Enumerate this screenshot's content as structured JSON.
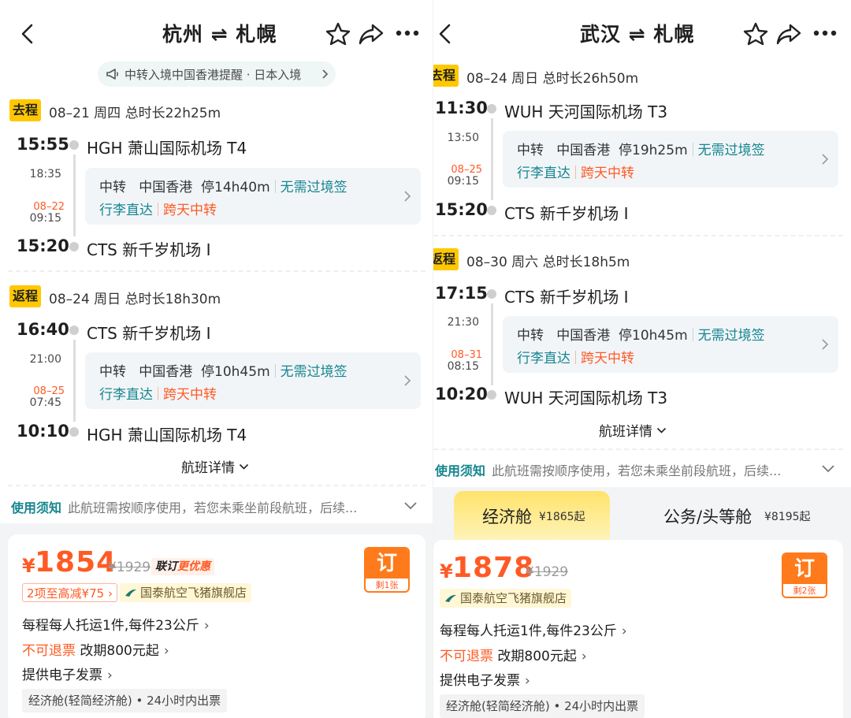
{
  "left": {
    "header": {
      "title": "杭州 ⇌ 札幌"
    },
    "notice": {
      "text": "中转入境中国香港提醒 · 日本入境"
    },
    "legs": [
      {
        "tag": "去程",
        "info": "08–21  周四  总时长22h25m",
        "dep_time": "15:55",
        "dep_airport": "HGH 萧山国际机场 T4",
        "mid_time1": "18:35",
        "mid_date2": "08–22",
        "mid_time2": "09:15",
        "transfer": {
          "label": "中转",
          "city": "中国香港",
          "stay": "停14h40m",
          "visa": "无需过境签",
          "baggage": "行李直达",
          "cross_day": "跨天中转"
        },
        "arr_time": "15:20",
        "arr_airport": "CTS 新千岁机场 I"
      },
      {
        "tag": "返程",
        "info": "08–24  周日  总时长18h30m",
        "dep_time": "16:40",
        "dep_airport": "CTS 新千岁机场 I",
        "mid_time1": "21:00",
        "mid_date2": "08–25",
        "mid_time2": "07:45",
        "transfer": {
          "label": "中转",
          "city": "中国香港",
          "stay": "停10h45m",
          "visa": "无需过境签",
          "baggage": "行李直达",
          "cross_day": "跨天中转"
        },
        "arr_time": "10:10",
        "arr_airport": "HGH 萧山国际机场 T4"
      }
    ],
    "flight_detail": "航班详情",
    "usage": {
      "label": "使用须知",
      "text": "此航班需按顺序使用，若您未乘坐前段航班，后续..."
    },
    "offer": {
      "currency": "¥",
      "price": "1854",
      "original": "¥1929",
      "combo_a": "联订",
      "combo_b": "更优惠",
      "promo": "2项至高减¥75",
      "store": "国泰航空飞猪旗舰店",
      "book_label": "订",
      "remaining": "剩1张",
      "baggage_rule": "每程每人托运1件,每件23公斤",
      "refund": "不可退票",
      "change": "改期800元起",
      "invoice": "提供电子发票",
      "cabin": "经济舱(轻简经济舱) • 24小时内出票"
    }
  },
  "right": {
    "header": {
      "title": "武汉 ⇌ 札幌"
    },
    "legs": [
      {
        "tag": "去程",
        "info": "08–24  周日  总时长26h50m",
        "dep_time": "11:30",
        "dep_airport": "WUH 天河国际机场 T3",
        "mid_time1": "13:50",
        "mid_date2": "08–25",
        "mid_time2": "09:15",
        "transfer": {
          "label": "中转",
          "city": "中国香港",
          "stay": "停19h25m",
          "visa": "无需过境签",
          "baggage": "行李直达",
          "cross_day": "跨天中转"
        },
        "arr_time": "15:20",
        "arr_airport": "CTS 新千岁机场 I"
      },
      {
        "tag": "返程",
        "info": "08–30  周六  总时长18h5m",
        "dep_time": "17:15",
        "dep_airport": "CTS 新千岁机场 I",
        "mid_time1": "21:30",
        "mid_date2": "08–31",
        "mid_time2": "08:15",
        "transfer": {
          "label": "中转",
          "city": "中国香港",
          "stay": "停10h45m",
          "visa": "无需过境签",
          "baggage": "行李直达",
          "cross_day": "跨天中转"
        },
        "arr_time": "10:20",
        "arr_airport": "WUH 天河国际机场 T3"
      }
    ],
    "flight_detail": "航班详情",
    "usage": {
      "label": "使用须知",
      "text": "此航班需按顺序使用，若您未乘坐前段航班，后续..."
    },
    "tabs": [
      {
        "name": "经济舱",
        "price": "¥1865起"
      },
      {
        "name": "公务/头等舱",
        "price": "¥8195起"
      }
    ],
    "offer": {
      "currency": "¥",
      "price": "1878",
      "original": "¥1929",
      "store": "国泰航空飞猪旗舰店",
      "book_label": "订",
      "remaining": "剩2张",
      "baggage_rule": "每程每人托运1件,每件23公斤",
      "refund": "不可退票",
      "change": "改期800元起",
      "invoice": "提供电子发票",
      "cabin": "经济舱(轻简经济舱) • 24小时内出票"
    }
  },
  "colors": {
    "accent_teal": "#15868f",
    "price_orange": "#ff5a24",
    "tag_yellow": "#ffc800",
    "book_orange": "#ff7a1a"
  }
}
